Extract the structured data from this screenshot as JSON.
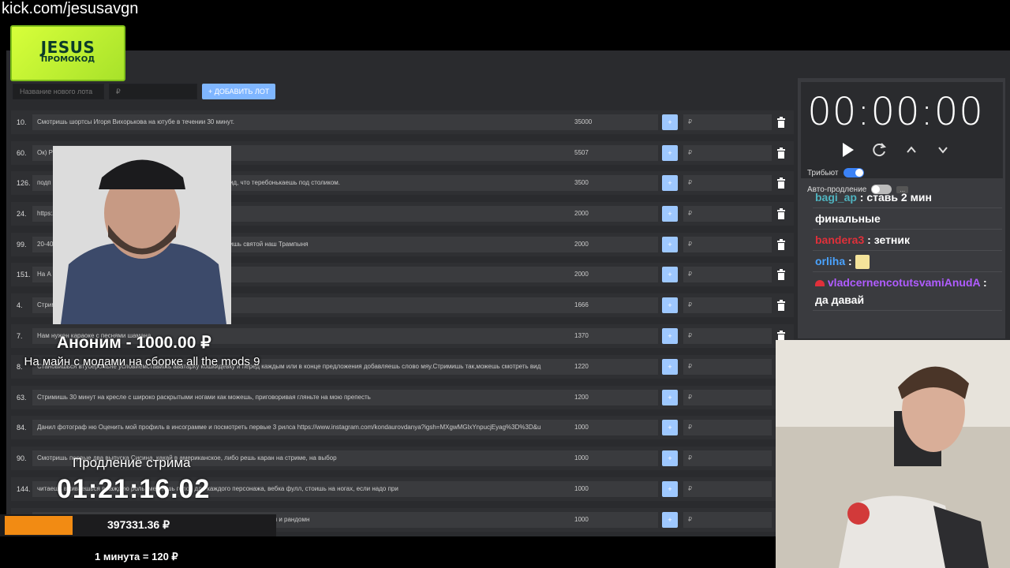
{
  "stream": {
    "url": "kick.com/jesusavgn"
  },
  "promo": {
    "line1": "JESUS",
    "line2": "ПРОМОКОД"
  },
  "add_lot": {
    "name_placeholder": "Название нового лота",
    "price_placeholder": "₽",
    "button_label": "+ ДОБАВИТЬ ЛОТ"
  },
  "lots": [
    {
      "num": "10.",
      "desc": "Смотришь шортсы Игоря Вихорькова на ютубе в течении 30 минут.",
      "amount": "35000",
      "rub": "₽"
    },
    {
      "num": "60.",
      "desc": "Ок) Р",
      "amount": "5507",
      "rub": "₽"
    },
    {
      "num": "126.",
      "desc": "подп                                             ваешь посты и сторис лайкая и коментируя. Иногда делай вид, что теребонькаешь под столиком.",
      "amount": "3500",
      "rub": "₽"
    },
    {
      "num": "24.",
      "desc": "https:/",
      "amount": "2000",
      "rub": "₽"
    },
    {
      "num": "99.",
      "desc": "20-40                                             кий рок стоя и вставешь на колени, молишься и потом кричишь святой наш Трампыня",
      "amount": "2000",
      "rub": "₽"
    },
    {
      "num": "151.",
      "desc": "На А",
      "amount": "2000",
      "rub": "₽"
    },
    {
      "num": "4.",
      "desc": "Стрим",
      "amount": "1666",
      "rub": "₽"
    },
    {
      "num": "7.",
      "desc": "Нам нужен караоке с песнями шамана",
      "amount": "1370",
      "rub": "₽"
    },
    {
      "num": "8.",
      "desc": "Становишься втуберомьне условиемставишь аватарку кошкидевку и перед каждым или в конце предложения добавляешь слово мяу.Стримишь так,можешь смотреть вид",
      "amount": "1220",
      "rub": "₽"
    },
    {
      "num": "63.",
      "desc": "Стримишь 30 минут на кресле с широко раскрытыми ногами как можешь, приговоривая гляньте на мою препесть",
      "amount": "1200",
      "rub": "₽"
    },
    {
      "num": "84.",
      "desc": "Данил фотограф ню Оценить мой профиль в инсограмме и посмотреть первые 3 рилса https://www.instagram.com/kondaurovdanya?igsh=MXgwMGlxYnpucjEyag%3D%3D&u",
      "amount": "1000",
      "rub": "₽"
    },
    {
      "num": "90.",
      "desc": "Смотришь первые два выпуска Сисина, какай в американское, либо решь каран на стриме, на выбор",
      "amount": "1000",
      "rub": "₽"
    },
    {
      "num": "144.",
      "desc": "читаешь                                             вживаешься в каждую роль, меняешь голос для каждого персонажа, вебка фулл, стоишь на ногах, если надо при",
      "amount": "1000",
      "rub": "₽"
    },
    {
      "num": "",
      "desc": "                                                                                          стер , обсуждаешь его с чатом и с чат гпт, нахваливать идею этого аниме и манги и рандомн",
      "amount": "1000",
      "rub": "₽"
    }
  ],
  "timer": {
    "value": "00:00:00"
  },
  "toggles": {
    "tribute_label": "Трибьют",
    "autoextend_label": "Авто-продление",
    "more_label": "..."
  },
  "chat": [
    {
      "user": "bagi_ap",
      "text": "ставь 2 мин",
      "user_color": "#4fb3bf"
    },
    {
      "user": "",
      "text": "финальные",
      "user_color": "#ffffff"
    },
    {
      "user": "bandera3",
      "text": "зетник",
      "user_color": "#e0303a"
    },
    {
      "user": "orliha",
      "text": "",
      "user_color": "#4aa3ff"
    },
    {
      "user": "vladcernencotutsvamiAnudA",
      "text": "да давай",
      "user_color": "#b05cff"
    }
  ],
  "donation": {
    "name": "Аноним - 1000.00 ₽",
    "message": "На майн с модами на сборке all the mods 9"
  },
  "extension": {
    "label": "Продление стрима",
    "timer": "01:21:16.02"
  },
  "goal": {
    "sum": "397331.36 ₽",
    "progress": 0.25
  },
  "rate": {
    "text": "1 минута = 120 ₽"
  },
  "colors": {
    "accent": "#3b82f6",
    "plus_button": "#9ec8ff",
    "goal_fill": "#f28b13"
  }
}
